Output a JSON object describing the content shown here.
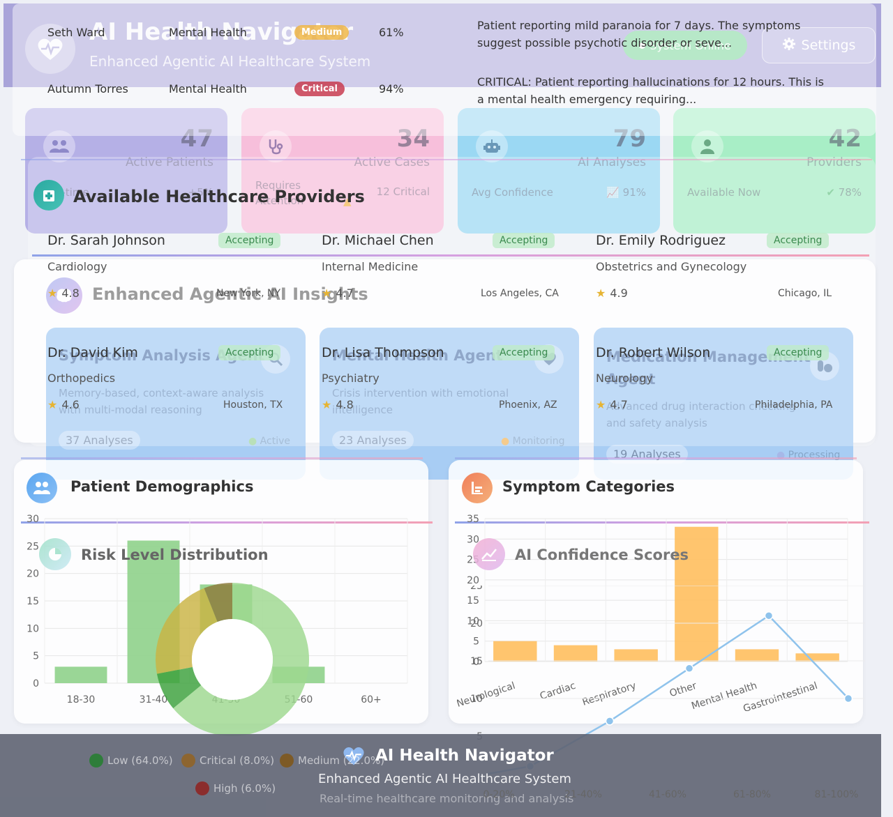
{
  "app": {
    "title": "AI Health Navigator",
    "subtitle": "Enhanced Agentic AI Healthcare System",
    "status": "System Online",
    "settings_label": "Settings"
  },
  "stats": [
    {
      "value": "47",
      "label": "Active Patients",
      "foot_left": "Real-time",
      "foot_right": "+5%",
      "icon": "users-icon",
      "color": "#a9a4e0"
    },
    {
      "value": "34",
      "label": "Active Cases",
      "foot_left": "Requires Attention",
      "foot_right": "12 Critical",
      "icon": "stethoscope-icon",
      "color": "#f6b9d7"
    },
    {
      "value": "79",
      "label": "AI Analyses",
      "foot_left": "Avg Confidence",
      "foot_right": "91%",
      "icon": "robot-icon",
      "color": "#9fdaf2"
    },
    {
      "value": "42",
      "label": "Providers",
      "foot_left": "Available Now",
      "foot_right": "78%",
      "icon": "doctor-icon",
      "color": "#a5ecc3"
    }
  ],
  "patients": [
    {
      "name": "Seth Ward",
      "category": "Mental Health",
      "level": "Medium",
      "confidence": "61%",
      "note": "Patient reporting mild paranoia for 7 days. The symptoms suggest possible psychotic disorder or seve..."
    },
    {
      "name": "Autumn Torres",
      "category": "Mental Health",
      "level": "Critical",
      "confidence": "94%",
      "note": "CRITICAL: Patient reporting hallucinations for 12 hours. This is a mental health emergency requiring..."
    }
  ],
  "providers_section": {
    "title": "Available Healthcare Providers"
  },
  "providers": [
    {
      "name": "Dr. Sarah Johnson",
      "status": "Accepting",
      "specialty": "Cardiology",
      "rating": "4.8",
      "location": "New York, NY"
    },
    {
      "name": "Dr. Michael Chen",
      "status": "Accepting",
      "specialty": "Internal Medicine",
      "rating": "4.7",
      "location": "Los Angeles, CA"
    },
    {
      "name": "Dr. Emily Rodriguez",
      "status": "Accepting",
      "specialty": "Obstetrics and Gynecology",
      "rating": "4.9",
      "location": "Chicago, IL"
    },
    {
      "name": "Dr. David Kim",
      "status": "Accepting",
      "specialty": "Orthopedics",
      "rating": "4.6",
      "location": "Houston, TX"
    },
    {
      "name": "Dr. Lisa Thompson",
      "status": "Accepting",
      "specialty": "Psychiatry",
      "rating": "4.8",
      "location": "Phoenix, AZ"
    },
    {
      "name": "Dr. Robert Wilson",
      "status": "Accepting",
      "specialty": "Neurology",
      "rating": "4.7",
      "location": "Philadelphia, PA"
    }
  ],
  "insights": {
    "title": "Enhanced Agentic AI Insights"
  },
  "agents": [
    {
      "name": "Symptom Analysis Agent",
      "desc": "Memory-based, context-aware analysis with multi-modal reasoning",
      "count": "37 Analyses",
      "status": "Active"
    },
    {
      "name": "Mental Health Agent",
      "desc": "Crisis intervention with emotional intelligence",
      "count": "23 Analyses",
      "status": "Monitoring"
    },
    {
      "name": "Medication Management Agent",
      "desc": "Advanced drug interaction checking and safety analysis",
      "count": "19 Analyses",
      "status": "Processing"
    }
  ],
  "demographics": {
    "title": "Patient Demographics"
  },
  "symptoms": {
    "title": "Symptom Categories"
  },
  "risk": {
    "title": "Risk Level Distribution"
  },
  "confidence": {
    "title": "AI Confidence Scores"
  },
  "footer": {
    "title": "AI Health Navigator",
    "subtitle": "Enhanced Agentic AI Healthcare System",
    "tagline": "Real-time healthcare monitoring and analysis"
  },
  "chart_data": [
    {
      "type": "bar",
      "title": "Patient Demographics",
      "categories": [
        "18-30",
        "31-40",
        "41-50",
        "51-60",
        "60+"
      ],
      "values": [
        3,
        26,
        18,
        3,
        0
      ],
      "ylim": [
        0,
        30
      ],
      "yticks": [
        0,
        5,
        10,
        15,
        20,
        25,
        30
      ],
      "color": "#8fd18b"
    },
    {
      "type": "bar",
      "title": "Symptom Categories",
      "categories": [
        "Neurological",
        "Cardiac",
        "Respiratory",
        "Other",
        "Mental Health",
        "Gastrointestinal"
      ],
      "values": [
        5,
        4,
        3,
        33,
        3,
        2
      ],
      "ylim": [
        0,
        35
      ],
      "yticks": [
        0,
        5,
        10,
        15,
        20,
        25,
        30,
        35
      ],
      "color": "#ffbf5e"
    },
    {
      "type": "pie",
      "title": "Risk Level Distribution",
      "series": [
        {
          "name": "Low",
          "value": 64.0,
          "label": "Low (64.0%)",
          "color": "#9ed88f"
        },
        {
          "name": "Critical",
          "value": 8.0,
          "label": "Critical (8.0%)",
          "color": "#3aa03a"
        },
        {
          "name": "Medium",
          "value": 22.0,
          "label": "Medium (22.0%)",
          "color": "#c9b343"
        },
        {
          "name": "High",
          "value": 6.0,
          "label": "High (6.0%)",
          "color": "#8d7a3a"
        }
      ],
      "legend_colors": {
        "Low": "#2e7d3a",
        "Critical": "#8d6530",
        "Medium": "#7d5a26",
        "High": "#8b2d2d"
      }
    },
    {
      "type": "line",
      "title": "AI Confidence Scores",
      "categories": [
        "0-20%",
        "21-40%",
        "41-60%",
        "61-80%",
        "81-100%"
      ],
      "values": [
        1,
        7,
        14,
        21,
        10
      ],
      "ylim": [
        0,
        25
      ],
      "yticks": [
        5,
        10,
        15,
        20,
        25
      ],
      "color": "#8fc3ec"
    }
  ]
}
